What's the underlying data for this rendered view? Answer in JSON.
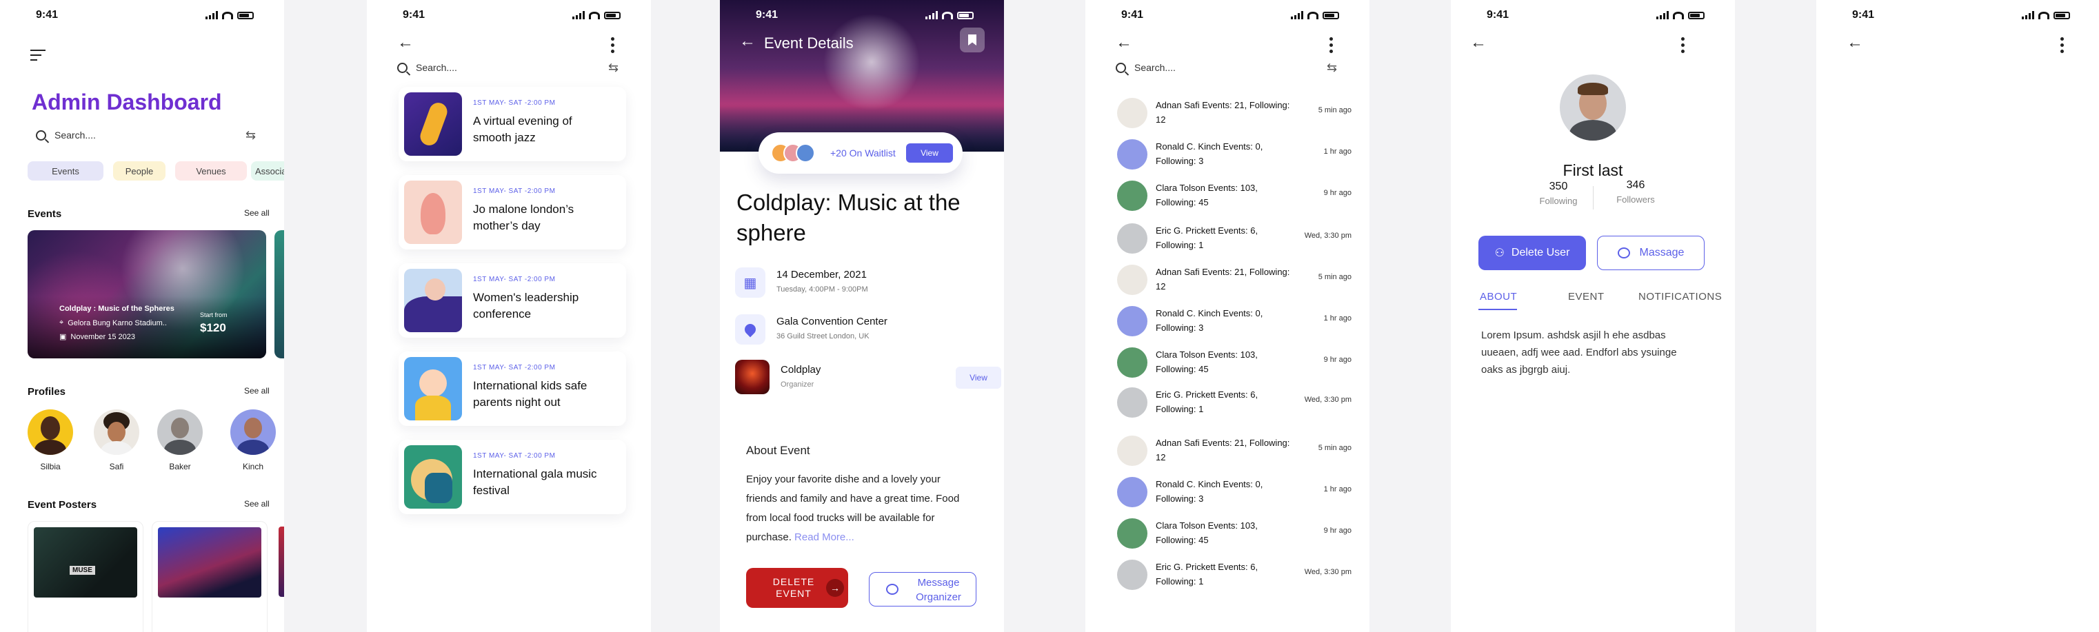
{
  "status": {
    "time": "9:41"
  },
  "dashboard": {
    "title": "Admin Dashboard",
    "search_placeholder": "Search....",
    "chips": [
      "Events",
      "People",
      "Venues",
      "Associa"
    ],
    "events_title": "Events",
    "see_all": "See all",
    "featured": {
      "title": "Coldplay : Music of the Spheres",
      "location": "Gelora Bung Karno Stadium..",
      "date": "November 15 2023",
      "price_label": "Start from",
      "price": "$120"
    },
    "profiles_title": "Profiles",
    "profiles": [
      "Silbia",
      "Safi",
      "Baker",
      "Kinch"
    ],
    "posters_title": "Event Posters",
    "poster_text": "MUSE"
  },
  "event_list": {
    "search_placeholder": "Search....",
    "items": [
      {
        "date": "1ST  MAY- SAT -2:00 PM",
        "title": "A virtual evening of smooth jazz"
      },
      {
        "date": "1ST  MAY- SAT -2:00 PM",
        "title": "Jo malone london’s mother’s day"
      },
      {
        "date": "1ST  MAY- SAT -2:00 PM",
        "title": "Women's leadership conference"
      },
      {
        "date": "1ST  MAY- SAT -2:00 PM",
        "title": "International kids safe parents night out"
      },
      {
        "date": "1ST  MAY- SAT -2:00 PM",
        "title": "International gala music festival"
      }
    ]
  },
  "event_details": {
    "header": "Event Details",
    "waitlist": "+20 On Waitlist",
    "view": "View",
    "title": "Coldplay: Music at the sphere",
    "date": "14 December, 2021",
    "time": "Tuesday, 4:00PM - 9:00PM",
    "venue": "Gala Convention Center",
    "address": "36 Guild Street London, UK",
    "organizer": "Coldplay",
    "organizer_role": "Organizer",
    "about_title": "About Event",
    "about_text": "Enjoy your favorite dishe and a lovely your friends and family and have a great time. Food from local food trucks will be available for purchase.",
    "read_more": "Read More...",
    "delete_label": "DELETE EVENT",
    "message_label": "Message Organizer"
  },
  "followers": {
    "search_placeholder": "Search....",
    "rows": [
      {
        "text": "Adnan Safi  Events: 21, Following: 12",
        "time": "5 min ago"
      },
      {
        "text": "Ronald C. Kinch Events: 0, Following: 3",
        "time": "1 hr ago"
      },
      {
        "text": "Clara Tolson Events: 103, Following: 45",
        "time": "9 hr ago"
      },
      {
        "text": "Eric G. Prickett Events: 6, Following: 1",
        "time": "Wed, 3:30 pm"
      },
      {
        "text": "Adnan Safi  Events: 21, Following: 12",
        "time": "5 min ago"
      },
      {
        "text": "Ronald C. Kinch Events: 0, Following: 3",
        "time": "1 hr ago"
      },
      {
        "text": "Clara Tolson Events: 103, Following: 45",
        "time": "9 hr ago"
      },
      {
        "text": "Eric G. Prickett Events: 6, Following: 1",
        "time": "Wed, 3:30 pm"
      },
      {
        "text": "Adnan Safi  Events: 21, Following: 12",
        "time": "5 min ago"
      },
      {
        "text": "Ronald C. Kinch Events: 0, Following: 3",
        "time": "1 hr ago"
      },
      {
        "text": "Clara Tolson Events: 103, Following: 45",
        "time": "9 hr ago"
      },
      {
        "text": "Eric G. Prickett Events: 6, Following: 1",
        "time": "Wed, 3:30 pm"
      }
    ]
  },
  "profile": {
    "name": "First last",
    "following_count": "350",
    "following_label": "Following",
    "followers_count": "346",
    "followers_label": "Followers",
    "delete_label": "Delete User",
    "message_label": "Massage",
    "tabs": [
      "ABOUT",
      "EVENT",
      "NOTIFICATIONS"
    ],
    "about_text": "Lorem Ipsum. ashdsk asjil h ehe asdbas uueaen, adfj wee aad. Endforl abs ysuinge oaks as jbgrgb aiuj."
  },
  "colors": {
    "primary": "#5b5fe8",
    "title_purple": "#6f2fd1",
    "danger": "#c41e1e"
  }
}
